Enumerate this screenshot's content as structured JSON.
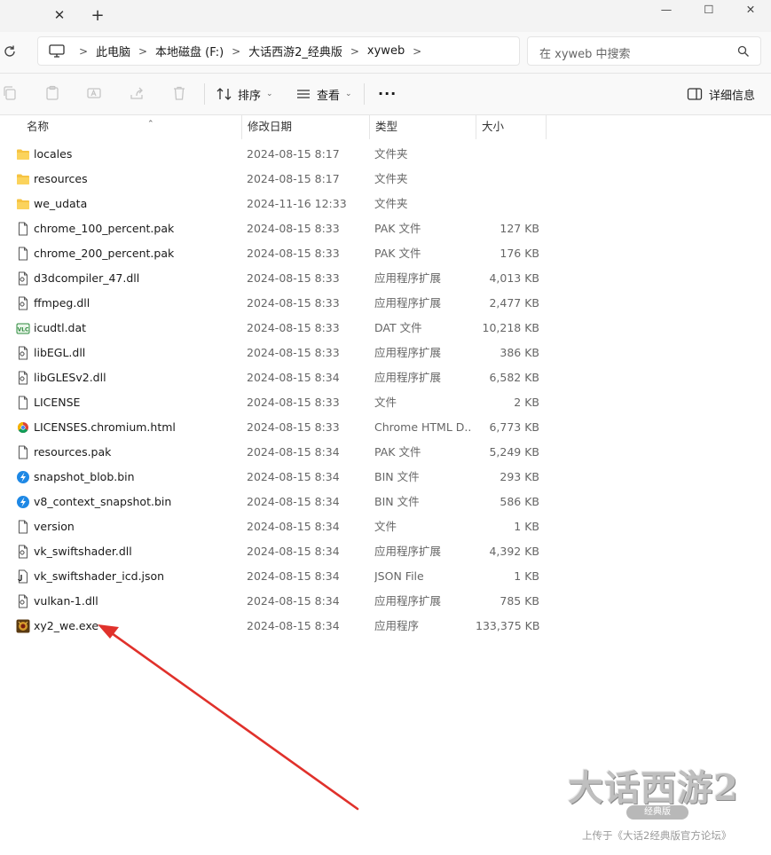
{
  "window": {
    "tab_close": "✕",
    "tab_add": "+",
    "minimize": "—",
    "maximize": "☐",
    "close": "✕"
  },
  "address": {
    "crumbs": [
      "此电脑",
      "本地磁盘 (F:)",
      "大话西游2_经典版",
      "xyweb"
    ]
  },
  "search": {
    "placeholder": "在 xyweb 中搜索"
  },
  "toolbar": {
    "sort_label": "排序",
    "view_label": "查看",
    "more_label": "···",
    "details_label": "详细信息"
  },
  "columns": {
    "name": "名称",
    "date": "修改日期",
    "type": "类型",
    "size": "大小"
  },
  "files": [
    {
      "name": "locales",
      "date": "2024-08-15 8:17",
      "type": "文件夹",
      "size": "",
      "icon": "folder-icon"
    },
    {
      "name": "resources",
      "date": "2024-08-15 8:17",
      "type": "文件夹",
      "size": "",
      "icon": "folder-icon"
    },
    {
      "name": "we_udata",
      "date": "2024-11-16 12:33",
      "type": "文件夹",
      "size": "",
      "icon": "folder-icon"
    },
    {
      "name": "chrome_100_percent.pak",
      "date": "2024-08-15 8:33",
      "type": "PAK 文件",
      "size": "127 KB",
      "icon": "file-icon"
    },
    {
      "name": "chrome_200_percent.pak",
      "date": "2024-08-15 8:33",
      "type": "PAK 文件",
      "size": "176 KB",
      "icon": "file-icon"
    },
    {
      "name": "d3dcompiler_47.dll",
      "date": "2024-08-15 8:33",
      "type": "应用程序扩展",
      "size": "4,013 KB",
      "icon": "dll-icon"
    },
    {
      "name": "ffmpeg.dll",
      "date": "2024-08-15 8:33",
      "type": "应用程序扩展",
      "size": "2,477 KB",
      "icon": "dll-icon"
    },
    {
      "name": "icudtl.dat",
      "date": "2024-08-15 8:33",
      "type": "DAT 文件",
      "size": "10,218 KB",
      "icon": "dat-icon"
    },
    {
      "name": "libEGL.dll",
      "date": "2024-08-15 8:33",
      "type": "应用程序扩展",
      "size": "386 KB",
      "icon": "dll-icon"
    },
    {
      "name": "libGLESv2.dll",
      "date": "2024-08-15 8:34",
      "type": "应用程序扩展",
      "size": "6,582 KB",
      "icon": "dll-icon"
    },
    {
      "name": "LICENSE",
      "date": "2024-08-15 8:33",
      "type": "文件",
      "size": "2 KB",
      "icon": "file-icon"
    },
    {
      "name": "LICENSES.chromium.html",
      "date": "2024-08-15 8:33",
      "type": "Chrome HTML D...",
      "size": "6,773 KB",
      "icon": "chrome-icon"
    },
    {
      "name": "resources.pak",
      "date": "2024-08-15 8:34",
      "type": "PAK 文件",
      "size": "5,249 KB",
      "icon": "file-icon"
    },
    {
      "name": "snapshot_blob.bin",
      "date": "2024-08-15 8:34",
      "type": "BIN 文件",
      "size": "293 KB",
      "icon": "bin-icon"
    },
    {
      "name": "v8_context_snapshot.bin",
      "date": "2024-08-15 8:34",
      "type": "BIN 文件",
      "size": "586 KB",
      "icon": "bin-icon"
    },
    {
      "name": "version",
      "date": "2024-08-15 8:34",
      "type": "文件",
      "size": "1 KB",
      "icon": "file-icon"
    },
    {
      "name": "vk_swiftshader.dll",
      "date": "2024-08-15 8:34",
      "type": "应用程序扩展",
      "size": "4,392 KB",
      "icon": "dll-icon"
    },
    {
      "name": "vk_swiftshader_icd.json",
      "date": "2024-08-15 8:34",
      "type": "JSON File",
      "size": "1 KB",
      "icon": "json-icon"
    },
    {
      "name": "vulkan-1.dll",
      "date": "2024-08-15 8:34",
      "type": "应用程序扩展",
      "size": "785 KB",
      "icon": "dll-icon"
    },
    {
      "name": "xy2_we.exe",
      "date": "2024-08-15 8:34",
      "type": "应用程序",
      "size": "133,375 KB",
      "icon": "exe-icon"
    }
  ],
  "logo": {
    "title": "大话西游2",
    "subtitle": "经典版"
  },
  "watermark": "上传于《大话2经典版官方论坛》",
  "colors": {
    "folder": "#f6c342",
    "arrow": "#e0312b",
    "accent": "#0067c0"
  }
}
